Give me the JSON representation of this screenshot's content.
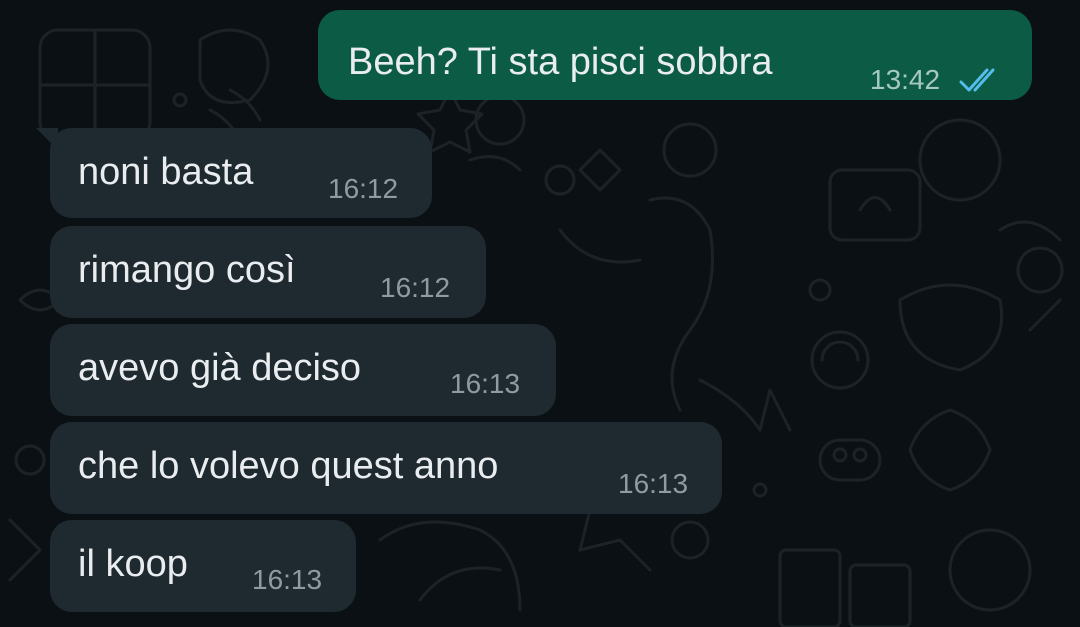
{
  "colors": {
    "background": "#0b1014",
    "outgoing_bubble": "#0b5b45",
    "incoming_bubble": "#1e2a30",
    "message_text": "#e9edef",
    "timestamp": "#8f9aa1",
    "read_ticks": "#53bdeb"
  },
  "messages": [
    {
      "direction": "outgoing",
      "text": "Beeh? Ti sta pisci sobbra",
      "time": "13:42",
      "status_icon": "double-check-read-icon"
    },
    {
      "direction": "incoming",
      "text": "noni basta",
      "time": "16:12"
    },
    {
      "direction": "incoming",
      "text": "rimango così",
      "time": "16:12"
    },
    {
      "direction": "incoming",
      "text": "avevo già deciso",
      "time": "16:13"
    },
    {
      "direction": "incoming",
      "text": "che lo volevo quest anno",
      "time": "16:13"
    },
    {
      "direction": "incoming",
      "text": "il koop",
      "time": "16:13"
    }
  ]
}
